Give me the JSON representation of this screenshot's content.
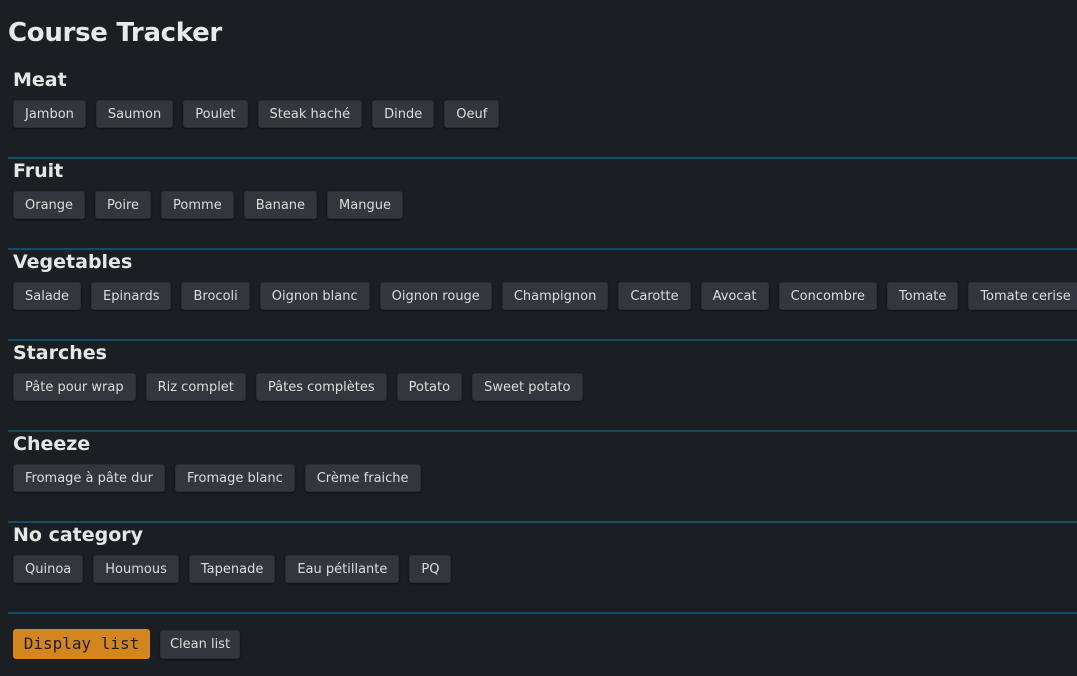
{
  "app": {
    "title": "Course Tracker"
  },
  "sections": [
    {
      "title": "Meat",
      "items": [
        "Jambon",
        "Saumon",
        "Poulet",
        "Steak haché",
        "Dinde",
        "Oeuf"
      ]
    },
    {
      "title": "Fruit",
      "items": [
        "Orange",
        "Poire",
        "Pomme",
        "Banane",
        "Mangue"
      ]
    },
    {
      "title": "Vegetables",
      "items": [
        "Salade",
        "Epinards",
        "Brocoli",
        "Oignon blanc",
        "Oignon rouge",
        "Champignon",
        "Carotte",
        "Avocat",
        "Concombre",
        "Tomate",
        "Tomate cerise"
      ]
    },
    {
      "title": "Starches",
      "items": [
        "Pâte pour wrap",
        "Riz complet",
        "Pâtes complètes",
        "Potato",
        "Sweet potato"
      ]
    },
    {
      "title": "Cheeze",
      "items": [
        "Fromage à pâte dur",
        "Fromage blanc",
        "Crème fraiche"
      ]
    },
    {
      "title": "No category",
      "items": [
        "Quinoa",
        "Houmous",
        "Tapenade",
        "Eau pétillante",
        "PQ"
      ]
    }
  ],
  "actions": {
    "display_label": "Display list",
    "clean_label": "Clean list"
  },
  "colors": {
    "background": "#1b1f24",
    "chip": "#33373d",
    "divider": "#0f5068",
    "accent": "#d3861d"
  }
}
